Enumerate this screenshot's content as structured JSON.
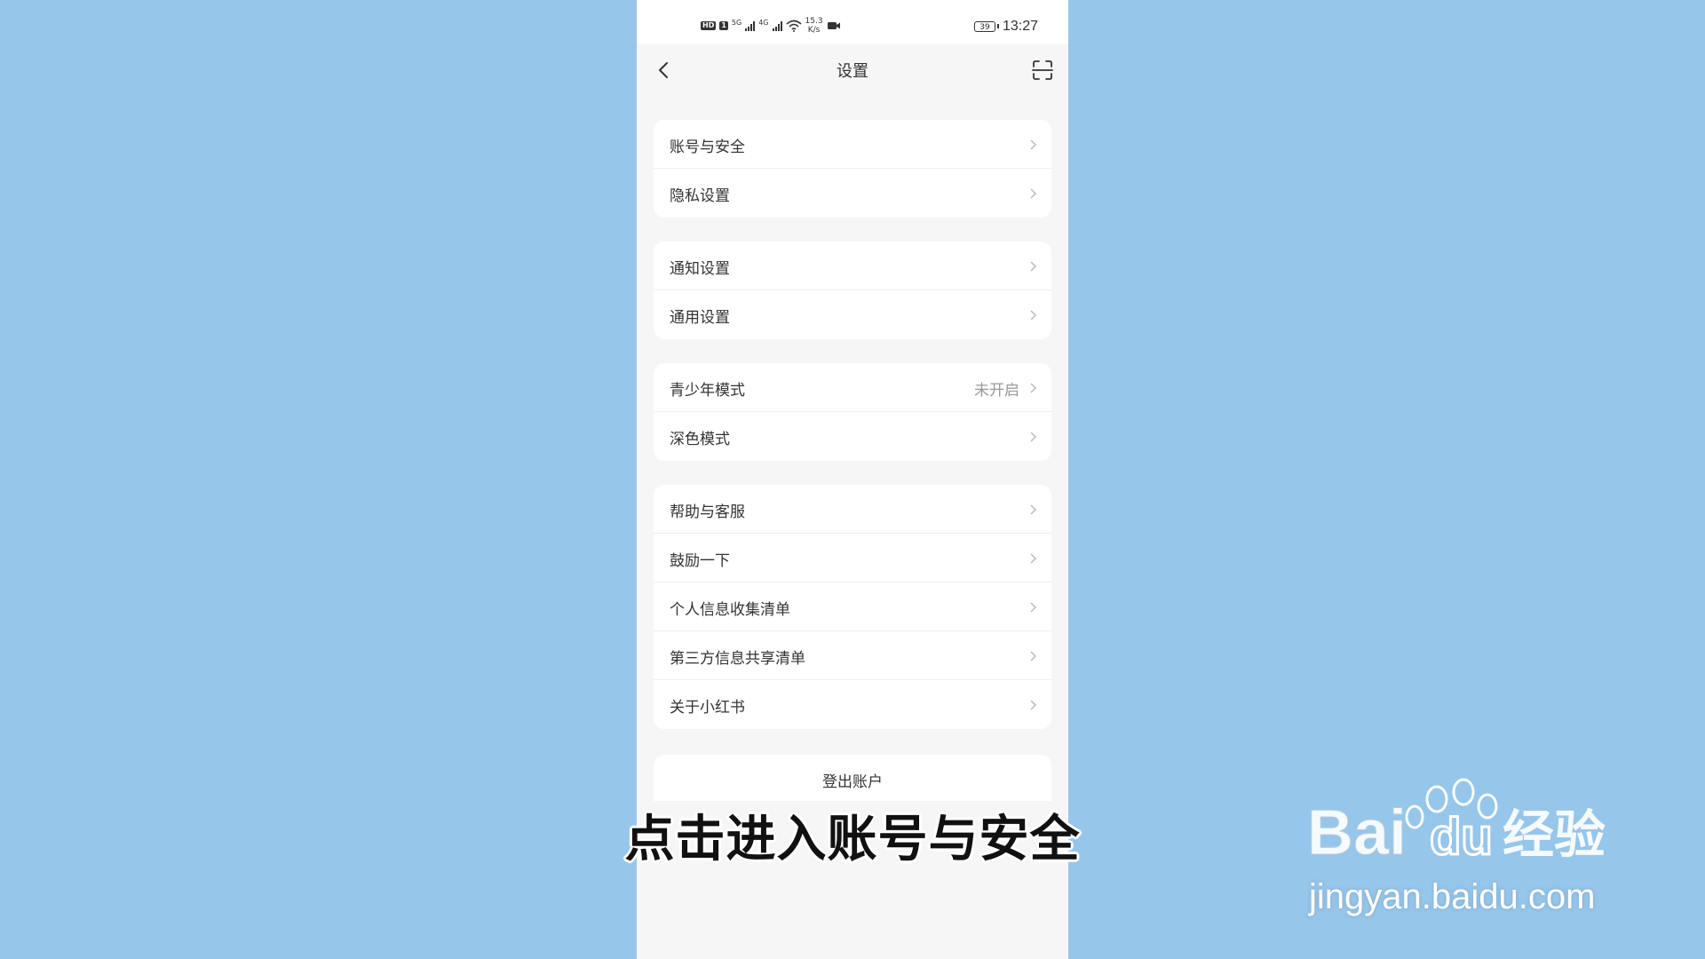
{
  "statusbar": {
    "hd_label": "HD",
    "sim_label": "1",
    "net1": "5G",
    "net2": "4G",
    "speed_value": "15.3",
    "speed_unit": "K/s",
    "battery": "39",
    "time": "13:27"
  },
  "header": {
    "title": "设置"
  },
  "groups": [
    {
      "items": [
        {
          "label": "账号与安全"
        },
        {
          "label": "隐私设置"
        }
      ]
    },
    {
      "items": [
        {
          "label": "通知设置"
        },
        {
          "label": "通用设置"
        }
      ]
    },
    {
      "items": [
        {
          "label": "青少年模式",
          "status": "未开启"
        },
        {
          "label": "深色模式"
        }
      ]
    },
    {
      "items": [
        {
          "label": "帮助与客服"
        },
        {
          "label": "鼓励一下"
        },
        {
          "label": "个人信息收集清单"
        },
        {
          "label": "第三方信息共享清单"
        },
        {
          "label": "关于小红书"
        }
      ]
    }
  ],
  "logout": {
    "label": "登出账户"
  },
  "caption": "点击进入账号与安全",
  "watermark": {
    "url": "jingyan.baidu.com"
  },
  "colors": {
    "background": "#96c6ea",
    "screen": "#f6f6f6",
    "card": "#ffffff",
    "text": "#333333",
    "muted": "#999999"
  }
}
